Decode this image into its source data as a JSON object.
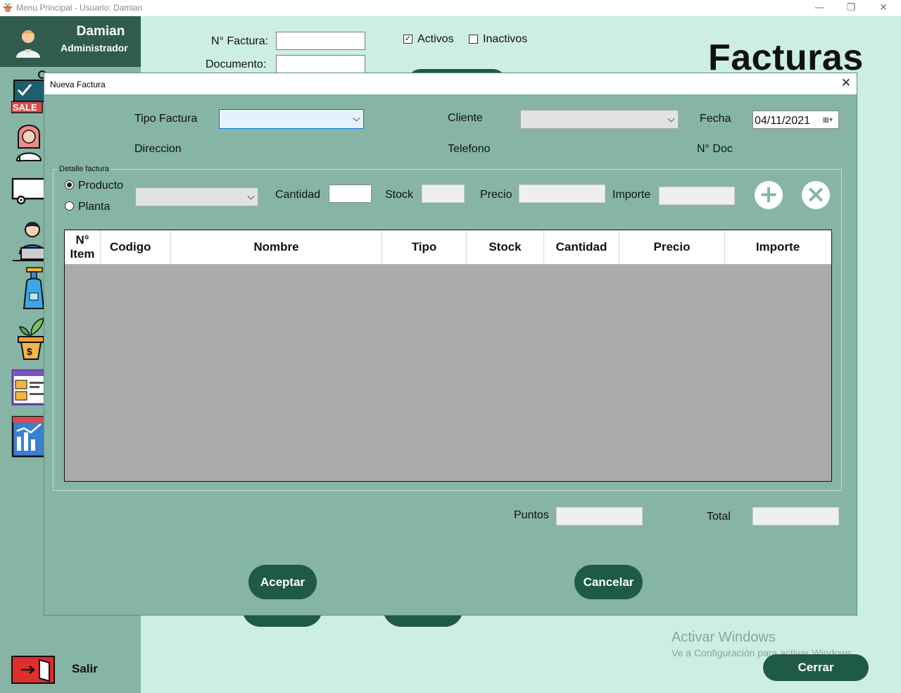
{
  "window": {
    "title": "Menu Principal - Usuario: Damian",
    "min_glyph": "—",
    "restore_glyph": "❐",
    "close_glyph": "✕"
  },
  "user": {
    "name": "Damian",
    "role": "Administrador"
  },
  "filters": {
    "factura_label": "N° Factura:",
    "documento_label": "Documento:",
    "activos_label": "Activos",
    "activos_checked": true,
    "inactivos_label": "Inactivos",
    "inactivos_checked": false,
    "check_glyph": "✓"
  },
  "page_title": "Facturas",
  "sidebar": {
    "sale_badge": "SALE",
    "salir_label": "Salir",
    "items": [
      {
        "icon": "sale-tag-icon"
      },
      {
        "icon": "employee-icon"
      },
      {
        "icon": "truck-icon"
      },
      {
        "icon": "customer-icon"
      },
      {
        "icon": "spray-bottle-icon"
      },
      {
        "icon": "plant-pot-icon"
      },
      {
        "icon": "report-window-icon"
      },
      {
        "icon": "statistics-icon"
      }
    ]
  },
  "main_buttons": {
    "cerrar": "Cerrar"
  },
  "watermark": {
    "line1": "Activar Windows",
    "line2": "Ve a Configuración para activar Windows."
  },
  "dialog": {
    "title": "Nueva Factura",
    "close_glyph": "✕",
    "tipo_factura_label": "Tipo Factura",
    "cliente_label": "Cliente",
    "fecha_label": "Fecha",
    "fecha_value": "04/11/2021",
    "calendar_glyph": "▦▾",
    "direccion_label": "Direccion",
    "telefono_label": "Telefono",
    "ndoc_label": "N° Doc",
    "detalle": {
      "legend": "Detalle factura",
      "producto_label": "Producto",
      "producto_selected": true,
      "planta_label": "Planta",
      "cantidad_label": "Cantidad",
      "stock_label": "Stock",
      "precio_label": "Precio",
      "importe_label": "Importe",
      "add_glyph": "+",
      "remove_glyph": "×",
      "columns": [
        "N° Item",
        "Codigo",
        "Nombre",
        "Tipo",
        "Stock",
        "Cantidad",
        "Precio",
        "Importe"
      ]
    },
    "puntos_label": "Puntos",
    "total_label": "Total",
    "aceptar_label": "Aceptar",
    "cancelar_label": "Cancelar"
  },
  "colors": {
    "background": "#cdeee4",
    "sidebar": "#86b5a5",
    "user_box": "#2f5c4d",
    "button": "#1e5a44",
    "grid_body": "#ababab"
  }
}
